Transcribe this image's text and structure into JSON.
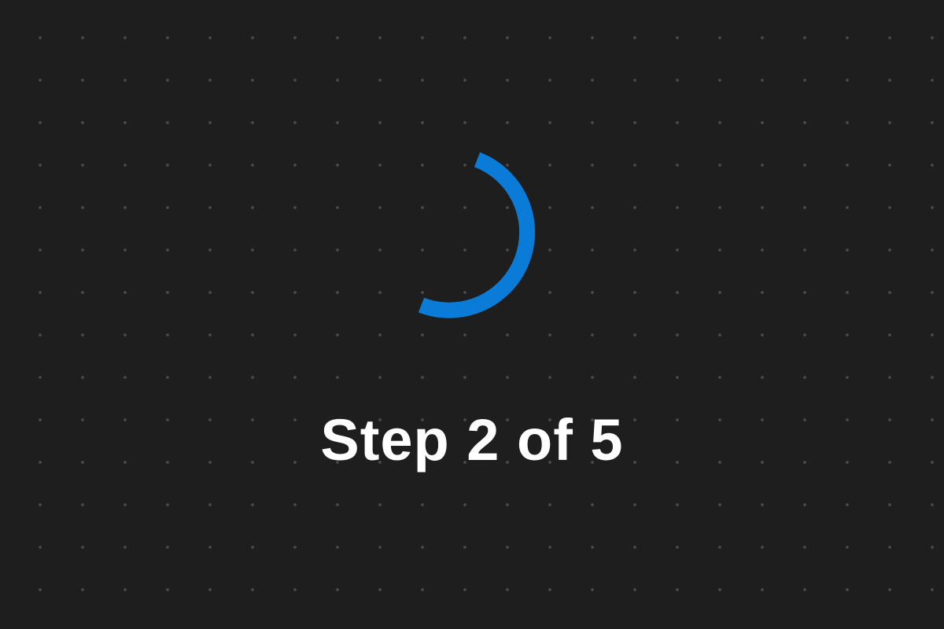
{
  "status": {
    "text": "Step 2 of 5",
    "current_step": 2,
    "total_steps": 5
  },
  "spinner": {
    "icon": "loading-spinner-icon",
    "color": "#0a7bd6"
  },
  "background": {
    "color": "#1e1e1e",
    "dot_color": "#4a4a4a"
  }
}
